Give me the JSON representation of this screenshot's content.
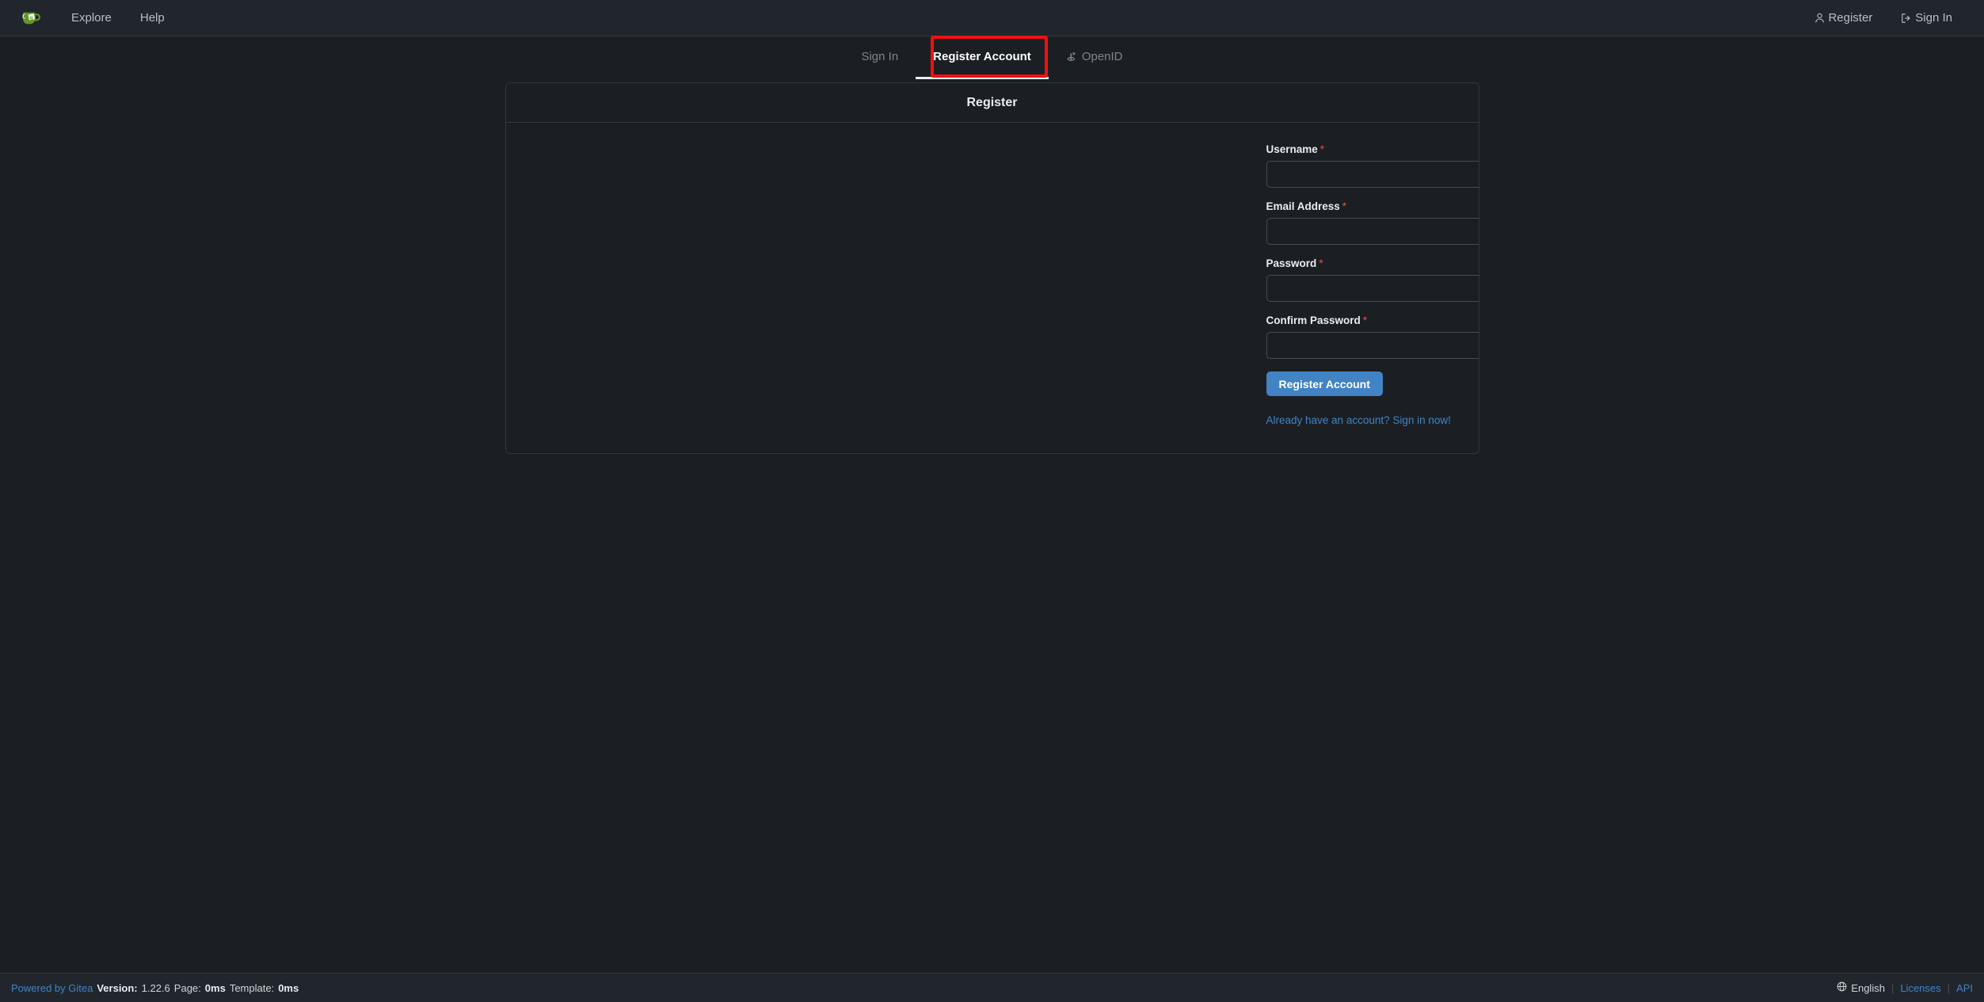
{
  "navbar": {
    "logo_name": "gitea-logo",
    "left_links": [
      {
        "label": "Explore",
        "name": "nav-explore"
      },
      {
        "label": "Help",
        "name": "nav-help"
      }
    ],
    "right_links": [
      {
        "label": "Register",
        "icon": "person-icon",
        "name": "nav-register"
      },
      {
        "label": "Sign In",
        "icon": "sign-in-icon",
        "name": "nav-sign-in"
      }
    ]
  },
  "tabs": [
    {
      "label": "Sign In",
      "active": false,
      "icon": null
    },
    {
      "label": "Register Account",
      "active": true,
      "icon": null
    },
    {
      "label": "OpenID",
      "active": false,
      "icon": "openid-icon"
    }
  ],
  "annotation": {
    "type": "highlight-box",
    "color": "#ee1111",
    "target": "Register Account"
  },
  "card": {
    "title": "Register",
    "fields": [
      {
        "label": "Username",
        "required_mark": "*",
        "value": "",
        "placeholder": "",
        "type": "text",
        "name": "username-input"
      },
      {
        "label": "Email Address",
        "required_mark": "*",
        "value": "",
        "placeholder": "",
        "type": "email",
        "name": "email-input"
      },
      {
        "label": "Password",
        "required_mark": "*",
        "value": "",
        "placeholder": "",
        "type": "password",
        "name": "password-input"
      },
      {
        "label": "Confirm Password",
        "required_mark": "*",
        "value": "",
        "placeholder": "",
        "type": "password",
        "name": "confirm-password-input"
      }
    ],
    "submit_label": "Register Account",
    "signin_link": "Already have an account? Sign in now!"
  },
  "footer": {
    "powered_by": "Powered by Gitea",
    "version_label": "Version:",
    "version_value": "1.22.6",
    "page_label": "Page:",
    "page_value": "0ms",
    "template_label": "Template:",
    "template_value": "0ms",
    "language": "English",
    "licenses": "Licenses",
    "api": "API",
    "separator": "|"
  },
  "colors": {
    "page_bg": "#1b1f23",
    "navbar_bg": "#21262d",
    "accent_blue": "#4183c4",
    "link_blue": "#58a6ff",
    "required_red": "#e5534b",
    "annotation_red": "#ee1111",
    "border": "#30363d",
    "logo_green": "#609926"
  }
}
